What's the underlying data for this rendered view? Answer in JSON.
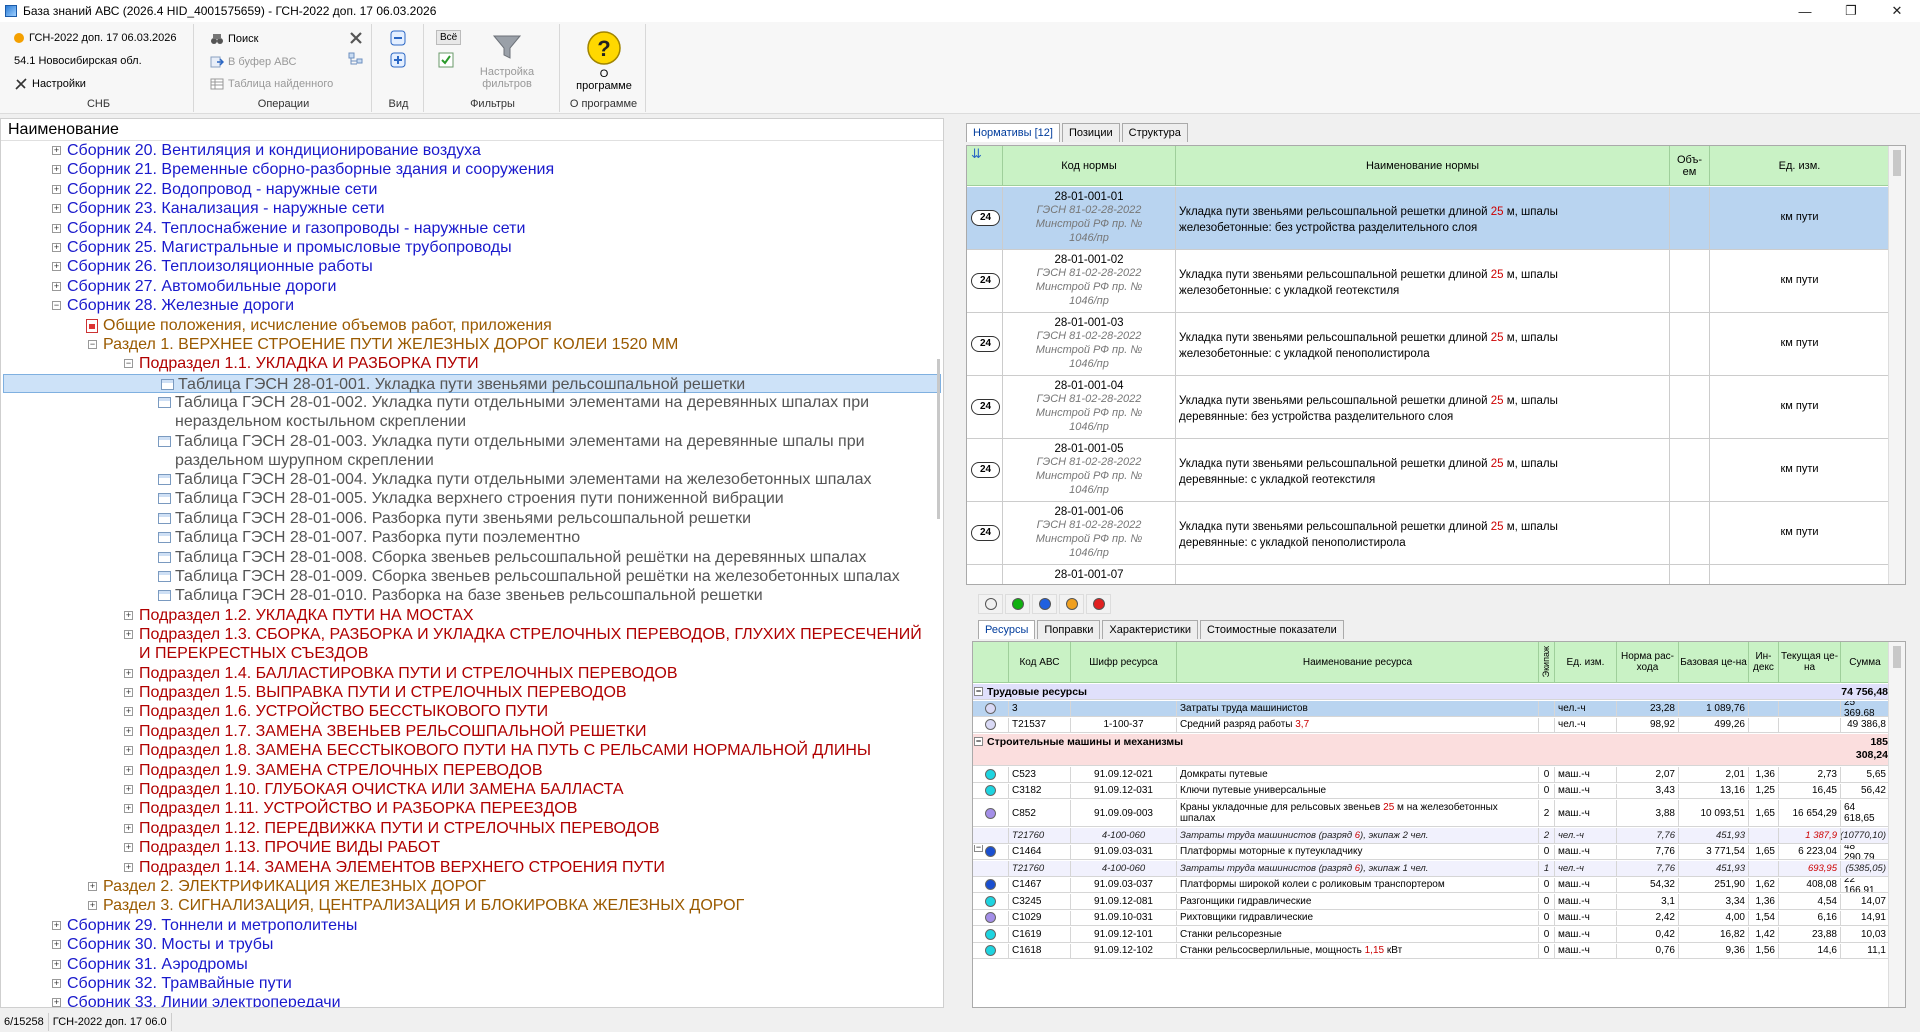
{
  "window": {
    "title": "База знаний АВС (2026.4 HID_4001575659) - ГСН-2022 доп. 17 06.03.2026",
    "minimize": "—",
    "maximize": "❐",
    "close": "✕"
  },
  "ribbon": {
    "snb": {
      "base": "ГСН-2022 доп. 17 06.03.2026",
      "region": "54.1 Новосибирская обл.",
      "settings": "Настройки",
      "label": "СНБ"
    },
    "ops": {
      "search": "Поиск",
      "to_buffer": "В буфер АВС",
      "found_table": "Таблица найденного",
      "label": "Операции"
    },
    "view": {
      "label": "Вид"
    },
    "filters": {
      "all": "Всё",
      "setup_line1": "Настройка",
      "setup_line2": "фильтров",
      "label": "Фильтры"
    },
    "about": {
      "btn_line1": "О",
      "btn_line2": "программе",
      "label": "О программе"
    }
  },
  "tree": {
    "header": "Наименование",
    "rows": [
      {
        "text": "Сборник 20. Вентиляция и кондиционирование воздуха"
      },
      {
        "text": "Сборник 21. Временные сборно-разборные здания и сооружения"
      },
      {
        "text": "Сборник 22. Водопровод - наружные сети"
      },
      {
        "text": "Сборник 23. Канализация - наружные сети"
      },
      {
        "text": "Сборник 24. Теплоснабжение и газопроводы - наружные сети"
      },
      {
        "text": "Сборник 25. Магистральные и промысловые трубопроводы"
      },
      {
        "text": "Сборник 26. Теплоизоляционные работы"
      },
      {
        "text": "Сборник 27. Автомобильные дороги"
      },
      {
        "text": "Сборник 28. Железные дороги"
      },
      {
        "text": "Общие положения, исчисление объемов работ, приложения"
      },
      {
        "text": "Раздел 1. ВЕРХНЕЕ СТРОЕНИЕ ПУТИ ЖЕЛЕЗНЫХ ДОРОГ КОЛЕИ 1520 ММ"
      },
      {
        "text": "Подраздел 1.1. УКЛАДКА И РАЗБОРКА ПУТИ"
      },
      {
        "text": "Таблица ГЭСН 28-01-001. Укладка пути звеньями рельсошпальной решетки"
      },
      {
        "text": "Таблица ГЭСН 28-01-002. Укладка пути отдельными элементами на деревянных шпалах при нераздельном костыльном скреплении"
      },
      {
        "text": "Таблица ГЭСН 28-01-003. Укладка пути отдельными элементами на деревянные шпалы при раздельном шурупном скреплении"
      },
      {
        "text": "Таблица ГЭСН 28-01-004. Укладка пути отдельными элементами на железобетонных шпалах"
      },
      {
        "text": "Таблица ГЭСН 28-01-005. Укладка верхнего строения пути пониженной вибрации"
      },
      {
        "text": "Таблица ГЭСН 28-01-006. Разборка пути звеньями рельсошпальной решетки"
      },
      {
        "text": "Таблица ГЭСН 28-01-007. Разборка пути поэлементно"
      },
      {
        "text": "Таблица ГЭСН 28-01-008. Сборка звеньев рельсошпальной решётки на деревянных шпалах"
      },
      {
        "text": "Таблица ГЭСН 28-01-009. Сборка звеньев рельсошпальной решётки на железобетонных шпалах"
      },
      {
        "text": "Таблица ГЭСН 28-01-010. Разборка на базе звеньев рельсошпальной решетки"
      },
      {
        "text": "Подраздел 1.2. УКЛАДКА ПУТИ НА МОСТАХ"
      },
      {
        "text": "Подраздел 1.3. СБОРКА, РАЗБОРКА И УКЛАДКА СТРЕЛОЧНЫХ ПЕРЕВОДОВ, ГЛУХИХ ПЕРЕСЕЧЕНИЙ И ПЕРЕКРЕСТНЫХ СЪЕЗДОВ"
      },
      {
        "text": "Подраздел 1.4. БАЛЛАСТИРОВКА ПУТИ И СТРЕЛОЧНЫХ ПЕРЕВОДОВ"
      },
      {
        "text": "Подраздел 1.5. ВЫПРАВКА ПУТИ И СТРЕЛОЧНЫХ ПЕРЕВОДОВ"
      },
      {
        "text": "Подраздел 1.6. УСТРОЙСТВО БЕССТЫКОВОГО ПУТИ"
      },
      {
        "text": "Подраздел 1.7. ЗАМЕНА ЗВЕНЬЕВ РЕЛЬСОШПАЛЬНОЙ РЕШЕТКИ"
      },
      {
        "text": "Подраздел 1.8. ЗАМЕНА БЕССТЫКОВОГО ПУТИ НА ПУТЬ С РЕЛЬСАМИ НОРМАЛЬНОЙ ДЛИНЫ"
      },
      {
        "text": "Подраздел 1.9. ЗАМЕНА СТРЕЛОЧНЫХ ПЕРЕВОДОВ"
      },
      {
        "text": "Подраздел 1.10. ГЛУБОКАЯ ОЧИСТКА ИЛИ ЗАМЕНА БАЛЛАСТА"
      },
      {
        "text": "Подраздел 1.11. УСТРОЙСТВО И РАЗБОРКА ПЕРЕЕЗДОВ"
      },
      {
        "text": "Подраздел 1.12. ПЕРЕДВИЖКА ПУТИ И СТРЕЛОЧНЫХ ПЕРЕВОДОВ"
      },
      {
        "text": "Подраздел 1.13. ПРОЧИЕ ВИДЫ РАБОТ"
      },
      {
        "text": "Подраздел 1.14. ЗАМЕНА ЭЛЕМЕНТОВ ВЕРХНЕГО СТРОЕНИЯ ПУТИ"
      },
      {
        "text": "Раздел 2. ЭЛЕКТРИФИКАЦИЯ ЖЕЛЕЗНЫХ ДОРОГ"
      },
      {
        "text": "Раздел 3. СИГНАЛИЗАЦИЯ, ЦЕНТРАЛИЗАЦИЯ И БЛОКИРОВКА ЖЕЛЕЗНЫХ ДОРОГ"
      },
      {
        "text": "Сборник 29. Тоннели и метрополитены"
      },
      {
        "text": "Сборник 30. Мосты и трубы"
      },
      {
        "text": "Сборник 31. Аэродромы"
      },
      {
        "text": "Сборник 32. Трамвайные пути"
      },
      {
        "text": "Сборник 33. Линии электропередачи"
      }
    ]
  },
  "status": {
    "count": "6/15258",
    "base": "ГСН-2022 доп. 17 06.0"
  },
  "norm_tabs": [
    "Нормативы [12]",
    "Позиции",
    "Структура"
  ],
  "norm_grid": {
    "headers": {
      "sort": "⇊",
      "code": "Код нормы",
      "name": "Наименование нормы",
      "vol_line1": "Объ-",
      "vol_line2": "ем",
      "unit": "Ед. изм."
    },
    "rows": [
      {
        "badge": "24",
        "code": "28-01-001-01",
        "src1": "ГЭСН 81-02-28-2022",
        "src2": "Минстрой РФ пр. №",
        "src3": "1046/пр",
        "name_a": "Укладка пути звеньями рельсошпальной решетки длиной ",
        "len": "25",
        "name_b": " м, шпалы железобетонные: без устройства разделительного слоя",
        "unit": "км пути"
      },
      {
        "badge": "24",
        "code": "28-01-001-02",
        "src1": "ГЭСН 81-02-28-2022",
        "src2": "Минстрой РФ пр. №",
        "src3": "1046/пр",
        "name_a": "Укладка пути звеньями рельсошпальной решетки длиной ",
        "len": "25",
        "name_b": " м, шпалы железобетонные: с укладкой геотекстиля",
        "unit": "км пути"
      },
      {
        "badge": "24",
        "code": "28-01-001-03",
        "src1": "ГЭСН 81-02-28-2022",
        "src2": "Минстрой РФ пр. №",
        "src3": "1046/пр",
        "name_a": "Укладка пути звеньями рельсошпальной решетки длиной ",
        "len": "25",
        "name_b": " м, шпалы железобетонные: с укладкой пенополистирола",
        "unit": "км пути"
      },
      {
        "badge": "24",
        "code": "28-01-001-04",
        "src1": "ГЭСН 81-02-28-2022",
        "src2": "Минстрой РФ пр. №",
        "src3": "1046/пр",
        "name_a": "Укладка пути звеньями рельсошпальной решетки длиной ",
        "len": "25",
        "name_b": " м, шпалы деревянные: без устройства разделительного слоя",
        "unit": "км пути"
      },
      {
        "badge": "24",
        "code": "28-01-001-05",
        "src1": "ГЭСН 81-02-28-2022",
        "src2": "Минстрой РФ пр. №",
        "src3": "1046/пр",
        "name_a": "Укладка пути звеньями рельсошпальной решетки длиной ",
        "len": "25",
        "name_b": " м, шпалы деревянные: с укладкой геотекстиля",
        "unit": "км пути"
      },
      {
        "badge": "24",
        "code": "28-01-001-06",
        "src1": "ГЭСН 81-02-28-2022",
        "src2": "Минстрой РФ пр. №",
        "src3": "1046/пр",
        "name_a": "Укладка пути звеньями рельсошпальной решетки длиной ",
        "len": "25",
        "name_b": " м, шпалы деревянные: с укладкой пенополистирола",
        "unit": "км пути"
      },
      {
        "badge": "",
        "code": "28-01-001-07",
        "src1": "",
        "src2": "",
        "src3": "",
        "name_a": "",
        "len": "",
        "name_b": "",
        "unit": ""
      }
    ]
  },
  "res_tabs": [
    "Ресурсы",
    "Поправки",
    "Характеристики",
    "Стоимостные показатели"
  ],
  "res_grid": {
    "headers": {
      "code": "Код АВС",
      "cipher": "Шифр ресурса",
      "name": "Наименование ресурса",
      "crew": "Экипаж",
      "unit": "Ед. изм.",
      "norm": "Норма рас-хода",
      "base": "Базовая це-на",
      "idx": "Ин-декс",
      "cur": "Текущая це-на",
      "sum": "Сумма"
    },
    "groups": [
      {
        "title": "Трудовые ресурсы",
        "sum": "74 756,48",
        "rows": [
          {
            "dot": "#d9d9f5",
            "code": "3",
            "cipher": "",
            "name_a": "Затраты труда машинистов",
            "red": "",
            "name_b": "",
            "crew": "",
            "unit": "чел.-ч",
            "norm": "23,28",
            "base": "1 089,76",
            "idx": "",
            "cur": "",
            "sum": "25 369,68",
            "sel": true
          },
          {
            "dot": "#d9d9f5",
            "code": "Т21537",
            "cipher": "1-100-37",
            "name_a": "Средний разряд работы ",
            "red": "3,7",
            "name_b": "",
            "crew": "",
            "unit": "чел.-ч",
            "norm": "98,92",
            "base": "499,26",
            "idx": "",
            "cur": "",
            "sum": "49 386,8"
          }
        ]
      },
      {
        "title": "Строительные машины и механизмы",
        "sum1": "185",
        "sum2": "308,24",
        "rows": [
          {
            "dot": "#1ed4e0",
            "code": "С523",
            "cipher": "91.09.12-021",
            "name_a": "Домкраты путевые",
            "red": "",
            "name_b": "",
            "crew": "0",
            "unit": "маш.-ч",
            "norm": "2,07",
            "base": "2,01",
            "idx": "1,36",
            "cur": "2,73",
            "sum": "5,65"
          },
          {
            "dot": "#1ed4e0",
            "code": "С3182",
            "cipher": "91.09.12-031",
            "name_a": "Ключи путевые универсальные",
            "red": "",
            "name_b": "",
            "crew": "0",
            "unit": "маш.-ч",
            "norm": "3,43",
            "base": "13,16",
            "idx": "1,25",
            "cur": "16,45",
            "sum": "56,42"
          },
          {
            "dot": "#a48fe8",
            "code": "С852",
            "cipher": "91.09.09-003",
            "name_a": "Краны укладочные для рельсовых звеньев ",
            "red": "25",
            "name_b": " м на железобетонных шпалах",
            "crew": "2",
            "unit": "маш.-ч",
            "norm": "3,88",
            "base": "10 093,51",
            "idx": "1,65",
            "cur": "16 654,29",
            "sum": "64 618,65",
            "tall": true
          },
          {
            "dot": "",
            "code": "Т21760",
            "cipher": "4-100-060",
            "name_a": "Затраты труда машинистов (разряд ",
            "red": "6",
            "name_b": "), экипаж 2 чел.",
            "crew": "2",
            "unit": "чел.-ч",
            "norm": "7,76",
            "base": "451,93",
            "idx": "",
            "cur": "1 387,9",
            "sum": "(10770,10)",
            "sub": true
          },
          {
            "dot": "#1a4fd0",
            "code": "С1464",
            "cipher": "91.09.03-031",
            "name_a": "Платформы моторные к путеукладчику",
            "red": "",
            "name_b": "",
            "crew": "0",
            "unit": "маш.-ч",
            "norm": "7,76",
            "base": "3 771,54",
            "idx": "1,65",
            "cur": "6 223,04",
            "sum": "48 290,79",
            "minus": true
          },
          {
            "dot": "",
            "code": "Т21760",
            "cipher": "4-100-060",
            "name_a": "Затраты труда машинистов (разряд ",
            "red": "6",
            "name_b": "), экипаж 1 чел.",
            "crew": "1",
            "unit": "чел.-ч",
            "norm": "7,76",
            "base": "451,93",
            "idx": "",
            "cur": "693,95",
            "sum": "(5385,05)",
            "sub": true
          },
          {
            "dot": "#1a4fd0",
            "code": "С1467",
            "cipher": "91.09.03-037",
            "name_a": "Платформы широкой колеи с роликовым транспортером",
            "red": "",
            "name_b": "",
            "crew": "0",
            "unit": "маш.-ч",
            "norm": "54,32",
            "base": "251,90",
            "idx": "1,62",
            "cur": "408,08",
            "sum": "22 166,91"
          },
          {
            "dot": "#1ed4e0",
            "code": "С3245",
            "cipher": "91.09.12-081",
            "name_a": "Разгонщики гидравлические",
            "red": "",
            "name_b": "",
            "crew": "0",
            "unit": "маш.-ч",
            "norm": "3,1",
            "base": "3,34",
            "idx": "1,36",
            "cur": "4,54",
            "sum": "14,07"
          },
          {
            "dot": "#a48fe8",
            "code": "С1029",
            "cipher": "91.09.10-031",
            "name_a": "Рихтовщики гидравлические",
            "red": "",
            "name_b": "",
            "crew": "0",
            "unit": "маш.-ч",
            "norm": "2,42",
            "base": "4,00",
            "idx": "1,54",
            "cur": "6,16",
            "sum": "14,91"
          },
          {
            "dot": "#1ed4e0",
            "code": "С1619",
            "cipher": "91.09.12-101",
            "name_a": "Станки рельсорезные",
            "red": "",
            "name_b": "",
            "crew": "0",
            "unit": "маш.-ч",
            "norm": "0,42",
            "base": "16,82",
            "idx": "1,42",
            "cur": "23,88",
            "sum": "10,03"
          },
          {
            "dot": "#1ed4e0",
            "code": "С1618",
            "cipher": "91.09.12-102",
            "name_a": "Станки рельсосверлильные, мощность ",
            "red": "1,15",
            "name_b": " кВт",
            "crew": "0",
            "unit": "маш.-ч",
            "norm": "0,76",
            "base": "9,36",
            "idx": "1,56",
            "cur": "14,6",
            "sum": "11,1"
          }
        ]
      }
    ]
  }
}
